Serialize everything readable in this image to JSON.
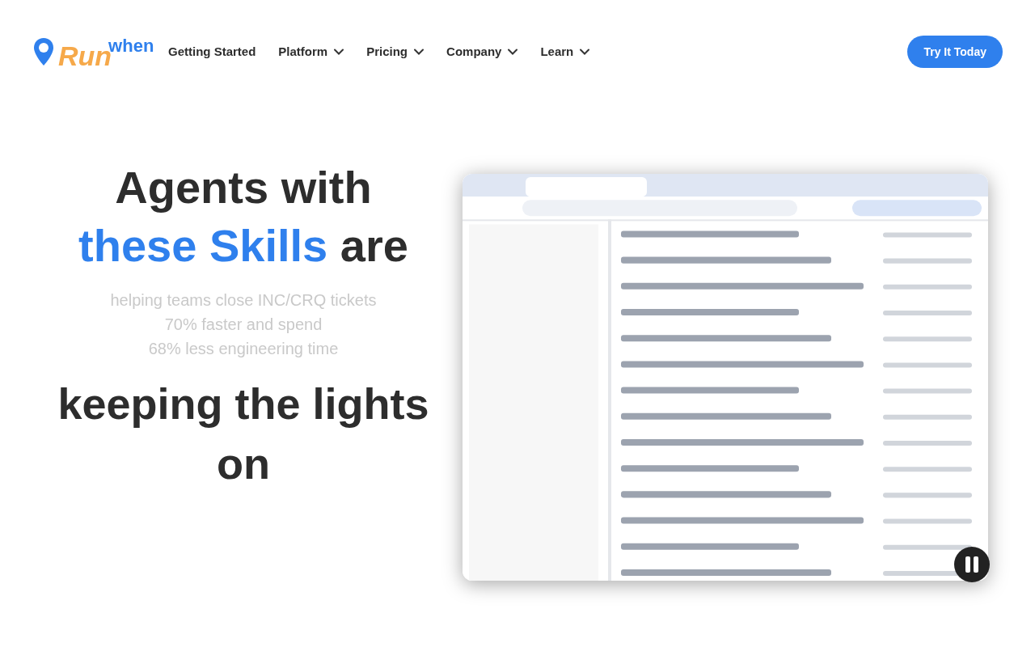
{
  "logo": {
    "word_top": "when",
    "word_main": "Run"
  },
  "nav": [
    {
      "label": "Getting Started",
      "kind": "link"
    },
    {
      "label": "Platform",
      "kind": "dropdown"
    },
    {
      "label": "Pricing",
      "kind": "dropdown"
    },
    {
      "label": "Company",
      "kind": "dropdown"
    },
    {
      "label": "Learn",
      "kind": "dropdown"
    }
  ],
  "cta": "Try It Today",
  "hero": {
    "headline_top": [
      [
        {
          "text": "Agents with",
          "highlight": false
        }
      ],
      [
        {
          "text": "these Skills",
          "highlight": true
        },
        {
          "text": " are",
          "highlight": false
        }
      ]
    ],
    "subtext": [
      "helping teams close INC/CRQ tickets",
      "70% faster and spend",
      "68% less engineering time"
    ],
    "headline_bottom": "keeping the lights on"
  },
  "video": {
    "playing": true
  }
}
